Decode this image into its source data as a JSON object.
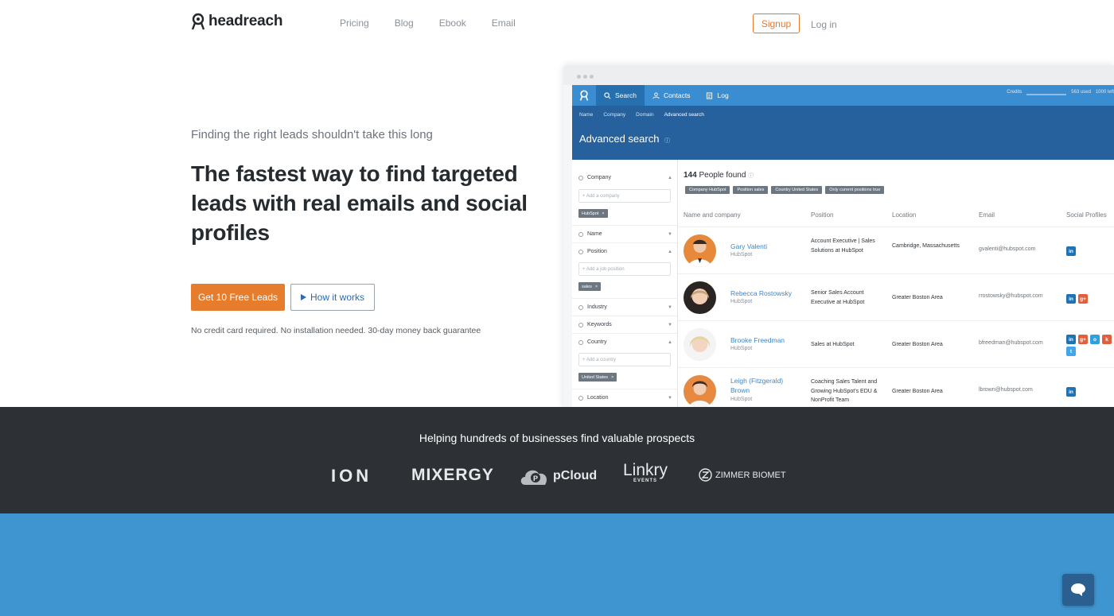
{
  "nav": {
    "logo_text": "headreach",
    "links": [
      "Pricing",
      "Blog",
      "Ebook",
      "Email"
    ],
    "signup_label": "Signup",
    "login_label": "Log in"
  },
  "hero": {
    "subtitle": "Finding the right leads shouldn't take this long",
    "title": "The fastest way to find targeted leads with real emails and social profiles",
    "primary_button": "Get 10 Free Leads",
    "secondary_button": "How it works",
    "note": "No credit card required. No installation needed. 30-day money back guarantee"
  },
  "app": {
    "tabs": [
      "Search",
      "Contacts",
      "Log"
    ],
    "credits_label": "Credits",
    "credits_used": "563 used",
    "credits_total": "1000 left",
    "sub_links": [
      "Name",
      "Company",
      "Domain",
      "Advanced search"
    ],
    "page_title": "Advanced search",
    "filters": {
      "company": "Company",
      "company_placeholder": "+ Add a company",
      "company_chip": "HubSpot",
      "name": "Name",
      "position": "Position",
      "position_placeholder": "+ Add a job position",
      "position_chip": "sales",
      "industry": "Industry",
      "keywords": "Keywords",
      "country": "Country",
      "country_placeholder": "+ Add a country",
      "country_chip": "United States",
      "location": "Location"
    },
    "results_count": "144",
    "results_label": "People found",
    "active_chips": [
      "Company HubSpot",
      "Position sales",
      "Country United States",
      "Only current positions true"
    ],
    "columns": [
      "Name and company",
      "Position",
      "Location",
      "Email",
      "Social Profiles"
    ],
    "rows": [
      {
        "name": "Gary Valenti",
        "company": "HubSpot",
        "position": "Account Executive | Sales Solutions at HubSpot",
        "location": "Cambridge, Massachusetts",
        "email": "gvalenti@hubspot.com",
        "social": [
          "in"
        ]
      },
      {
        "name": "Rebecca Rostowsky",
        "company": "HubSpot",
        "position": "Senior Sales Account Executive at HubSpot",
        "location": "Greater Boston Area",
        "email": "rrostowsky@hubspot.com",
        "social": [
          "in",
          "g+"
        ]
      },
      {
        "name": "Brooke Freedman",
        "company": "HubSpot",
        "position": "Sales at HubSpot",
        "location": "Greater Boston Area",
        "email": "bfreedman@hubspot.com",
        "social": [
          "in",
          "g+",
          "o",
          "k",
          "t"
        ]
      },
      {
        "name": "Leigh (Fitzgerald) Brown",
        "company": "HubSpot",
        "position": "Coaching Sales Talent and Growing HubSpot's EDU & NonProfit Team",
        "location": "Greater Boston Area",
        "email": "lbrown@hubspot.com",
        "social": [
          "in"
        ]
      }
    ]
  },
  "strip": {
    "title": "Helping hundreds of businesses find valuable prospects",
    "brands": [
      "ION",
      "MIXERGY",
      "pCloud",
      "Linkry",
      "EVENTS",
      "ZIMMER BIOMET"
    ]
  },
  "colors": {
    "accent_orange": "#e57d2c",
    "app_blue": "#3a8dd1",
    "dark_strip": "#2d3034",
    "section_blue": "#3f95cf"
  }
}
